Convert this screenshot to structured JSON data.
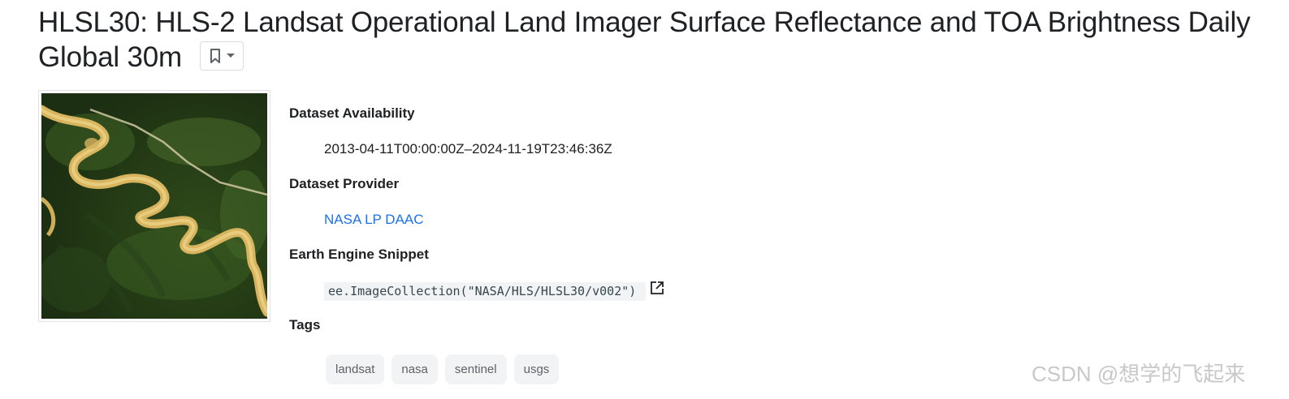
{
  "title": "HLSL30: HLS-2 Landsat Operational Land Imager Surface Reflectance and TOA Brightness Daily Global 30m",
  "icons": {
    "bookmark": "bookmark-icon",
    "dropdown": "caret-down-icon",
    "external_link": "open-in-new-icon"
  },
  "thumbnail": {
    "subject": "satellite image of a meandering river through forest"
  },
  "availability": {
    "label": "Dataset Availability",
    "value": "2013-04-11T00:00:00Z–2024-11-19T23:46:36Z"
  },
  "provider": {
    "label": "Dataset Provider",
    "value": "NASA LP DAAC"
  },
  "snippet": {
    "label": "Earth Engine Snippet",
    "value": "ee.ImageCollection(\"NASA/HLS/HLSL30/v002\")"
  },
  "tags": {
    "label": "Tags",
    "items": [
      "landsat",
      "nasa",
      "sentinel",
      "usgs"
    ]
  },
  "watermark": "CSDN @想学的飞起来",
  "colors": {
    "link": "#1a73e8",
    "tag_bg": "#f1f3f4",
    "title": "#202124"
  }
}
